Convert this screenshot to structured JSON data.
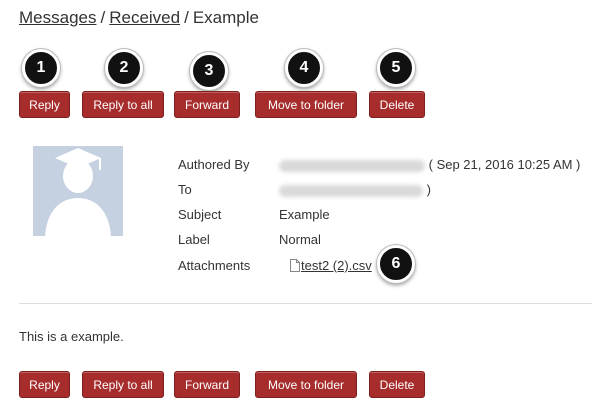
{
  "breadcrumb": {
    "items": [
      "Messages",
      "Received",
      "Example"
    ],
    "separator": "/"
  },
  "toolbar_top": {
    "reply": "Reply",
    "reply_all": "Reply to all",
    "forward": "Forward",
    "move": "Move to folder",
    "delete": "Delete"
  },
  "callouts": [
    "1",
    "2",
    "3",
    "4",
    "5",
    "6"
  ],
  "message": {
    "authored_by_label": "Authored By",
    "authored_date": "( Sep 21, 2016 10:25 AM )",
    "authored_close": ")",
    "to_label": "To",
    "subject_label": "Subject",
    "subject_value": "Example",
    "label_label": "Label",
    "label_value": "Normal",
    "attachments_label": "Attachments",
    "attachment_name": "test2 (2).csv",
    "body": "This is a example."
  },
  "toolbar_bottom": {
    "reply": "Reply",
    "reply_all": "Reply to all",
    "forward": "Forward",
    "move": "Move to folder",
    "delete": "Delete"
  },
  "colors": {
    "button_bg": "#a72c2c",
    "callout_bg": "#111111",
    "avatar_bg": "#c5d0e0"
  },
  "icons": {
    "avatar": "graduate-silhouette-icon",
    "attachment": "file-icon"
  }
}
